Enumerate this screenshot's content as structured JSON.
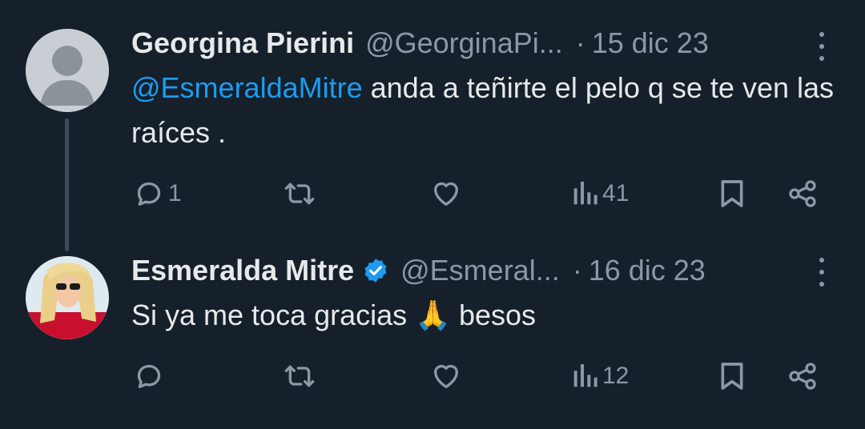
{
  "tweets": [
    {
      "name": "Georgina Pierini",
      "handle": "@GeorginaPi...",
      "separator": "·",
      "date": "15 dic 23",
      "mention": "@EsmeraldaMitre",
      "text": " anda a teñirte el pelo q se te ven las raíces .",
      "replies": "1",
      "views": "41"
    },
    {
      "name": "Esmeralda Mitre",
      "verified": true,
      "handle": "@Esmeral...",
      "separator": "·",
      "date": "16 dic 23",
      "text": "Si ya me toca gracias 🙏 besos",
      "replies": "",
      "views": "12"
    }
  ],
  "colors": {
    "background": "#15202b",
    "text": "#e7e9ea",
    "muted": "#8b98a5",
    "accent": "#1d9bf0",
    "thread_line": "#3e4a55"
  },
  "icons": [
    "default-avatar-icon",
    "verified-badge-icon",
    "more-options-icon",
    "reply-icon",
    "retweet-icon",
    "like-icon",
    "views-icon",
    "bookmark-icon",
    "share-icon"
  ]
}
